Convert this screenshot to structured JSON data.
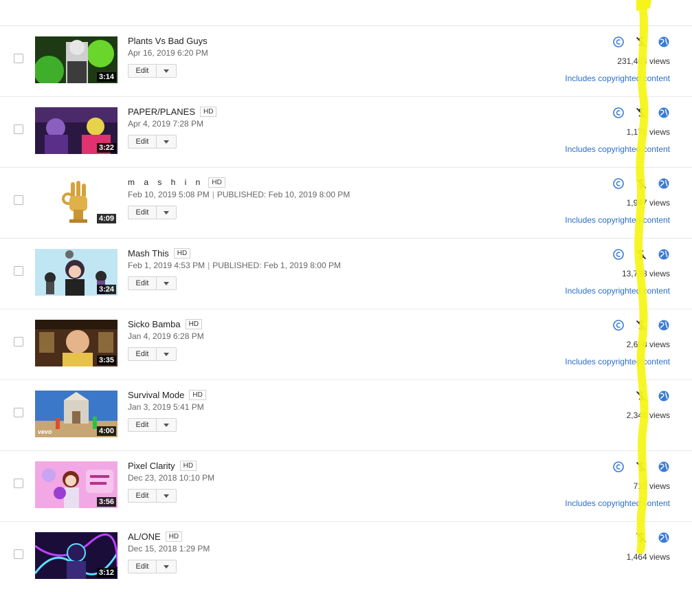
{
  "videos": [
    {
      "title": "Plants Vs Bad Guys",
      "hd": "",
      "date": "Apr 16, 2019 6:20 PM",
      "published": "",
      "duration": "3:14",
      "views": "231,403 views",
      "copyright_link": "Includes copyrighted content",
      "has_copyright_icon": true,
      "edit_label": "Edit",
      "thumb_bg": "#1d3a15",
      "thumb_accent": "#8fe33a"
    },
    {
      "title": "PAPER/PLANES",
      "hd": "HD",
      "date": "Apr 4, 2019 7:28 PM",
      "published": "",
      "duration": "3:22",
      "views": "1,176 views",
      "copyright_link": "Includes copyrighted content",
      "has_copyright_icon": true,
      "edit_label": "Edit",
      "thumb_bg": "#2a1842",
      "thumb_accent": "#e0326e"
    },
    {
      "title": "m a s h i n",
      "hd": "HD",
      "date": "Feb 10, 2019 5:08 PM",
      "published": "PUBLISHED: Feb 10, 2019 8:00 PM",
      "duration": "4:09",
      "views": "1,947 views",
      "copyright_link": "Includes copyrighted content",
      "has_copyright_icon": true,
      "edit_label": "Edit",
      "thumb_bg": "#ffffff",
      "thumb_accent": "#d4a23a"
    },
    {
      "title": "Mash This",
      "hd": "HD",
      "date": "Feb 1, 2019 4:53 PM",
      "published": "PUBLISHED: Feb 1, 2019 8:00 PM",
      "duration": "3:24",
      "views": "13,738 views",
      "copyright_link": "Includes copyrighted content",
      "has_copyright_icon": true,
      "edit_label": "Edit",
      "thumb_bg": "#bfe6f2",
      "thumb_accent": "#2b2b2b"
    },
    {
      "title": "Sicko Bamba",
      "hd": "HD",
      "date": "Jan 4, 2019 6:28 PM",
      "published": "",
      "duration": "3:35",
      "views": "2,658 views",
      "copyright_link": "Includes copyrighted content",
      "has_copyright_icon": true,
      "edit_label": "Edit",
      "thumb_bg": "#4a2e1a",
      "thumb_accent": "#e6b458"
    },
    {
      "title": "Survival Mode",
      "hd": "HD",
      "date": "Jan 3, 2019 5:41 PM",
      "published": "",
      "duration": "4:00",
      "views": "2,341 views",
      "copyright_link": "",
      "has_copyright_icon": false,
      "edit_label": "Edit",
      "thumb_bg": "#3b78c9",
      "thumb_accent": "#c8a574",
      "badge": "vevo"
    },
    {
      "title": "Pixel Clarity",
      "hd": "HD",
      "date": "Dec 23, 2018 10:10 PM",
      "published": "",
      "duration": "3:56",
      "views": "715 views",
      "copyright_link": "Includes copyrighted content",
      "has_copyright_icon": true,
      "edit_label": "Edit",
      "thumb_bg": "#f2a8e4",
      "thumb_accent": "#9b3fd1"
    },
    {
      "title": "AL/ONE",
      "hd": "HD",
      "date": "Dec 15, 2018 1:29 PM",
      "published": "",
      "duration": "3:12",
      "views": "1,464 views",
      "copyright_link": "",
      "has_copyright_icon": false,
      "edit_label": "Edit",
      "thumb_bg": "#1a0d3a",
      "thumb_accent": "#5de0ff"
    }
  ],
  "icons": {
    "copyright": "copyright-icon",
    "monetization": "monetization-off-icon",
    "visibility": "public-globe-icon"
  },
  "colors": {
    "link": "#2b6ec9",
    "icon_blue": "#3a7bd5",
    "highlight": "#f5f51a"
  }
}
